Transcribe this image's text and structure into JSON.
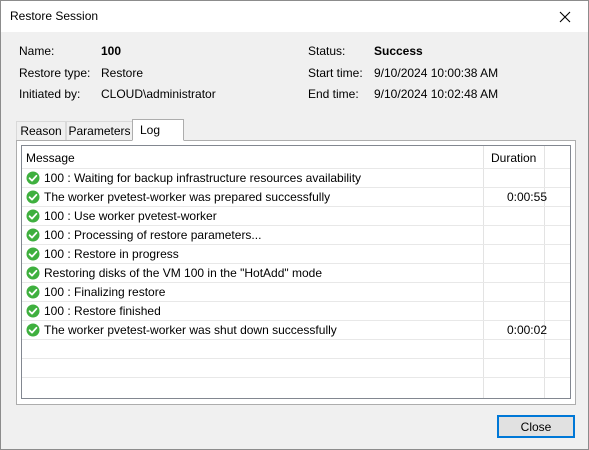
{
  "window": {
    "title": "Restore Session"
  },
  "info": {
    "name_label": "Name:",
    "name_value": "100",
    "restore_type_label": "Restore type:",
    "restore_type_value": "Restore",
    "initiated_by_label": "Initiated by:",
    "initiated_by_value": "CLOUD\\administrator",
    "status_label": "Status:",
    "status_value": "Success",
    "start_time_label": "Start time:",
    "start_time_value": "9/10/2024 10:00:38 AM",
    "end_time_label": "End time:",
    "end_time_value": "9/10/2024 10:02:48 AM"
  },
  "tabs": [
    {
      "label": "Reason"
    },
    {
      "label": "Parameters"
    },
    {
      "label": "Log"
    }
  ],
  "log": {
    "columns": {
      "message": "Message",
      "duration": "Duration"
    },
    "rows": [
      {
        "message": "100 : Waiting for backup infrastructure resources availability",
        "duration": ""
      },
      {
        "message": "The worker pvetest-worker was prepared successfully",
        "duration": "0:00:55"
      },
      {
        "message": "100 : Use worker pvetest-worker",
        "duration": ""
      },
      {
        "message": "100 : Processing of restore parameters...",
        "duration": ""
      },
      {
        "message": "100 : Restore in progress",
        "duration": ""
      },
      {
        "message": "Restoring disks of the VM 100 in the \"HotAdd\" mode",
        "duration": ""
      },
      {
        "message": "100 : Finalizing restore",
        "duration": ""
      },
      {
        "message": "100 : Restore finished",
        "duration": ""
      },
      {
        "message": "The worker pvetest-worker was shut down successfully",
        "duration": "0:00:02"
      }
    ]
  },
  "buttons": {
    "close_label": "Close"
  },
  "colors": {
    "success": "#3fb03f",
    "accent": "#0078d7"
  },
  "icons": {
    "status": "check-circle-icon",
    "window_close": "close-icon"
  }
}
